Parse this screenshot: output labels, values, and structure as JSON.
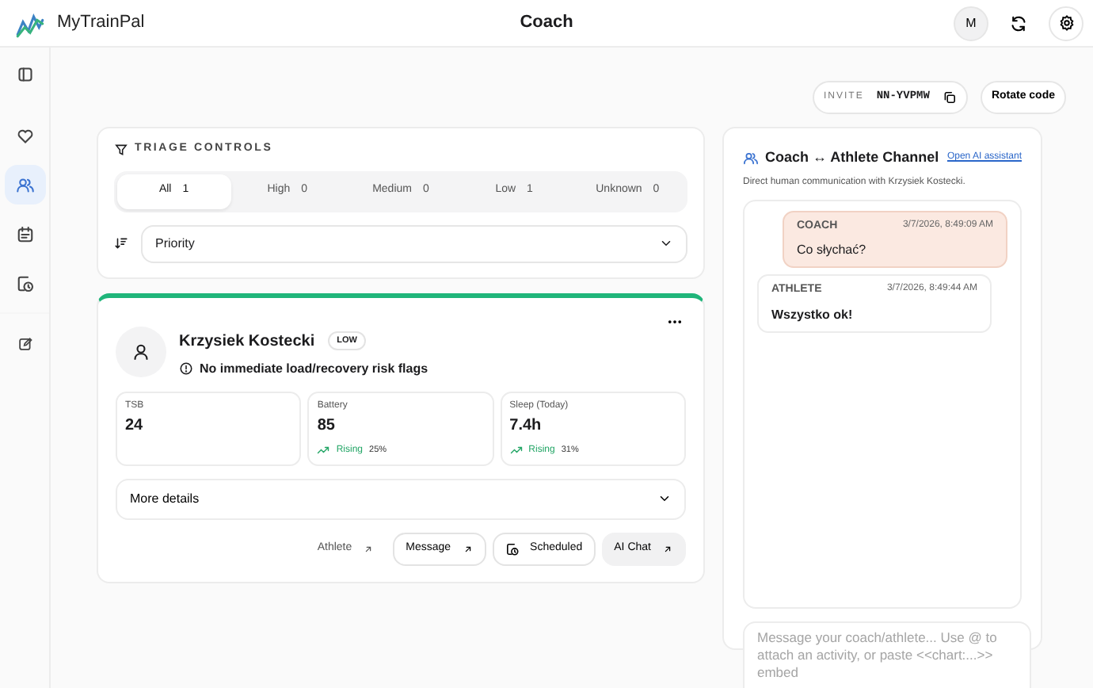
{
  "app": {
    "name": "MyTrainPal"
  },
  "header": {
    "title": "Coach",
    "avatar": "M"
  },
  "sidebar": {
    "items": [
      {
        "selected": false
      },
      {
        "selected": false
      },
      {
        "selected": true
      },
      {
        "selected": false
      },
      {
        "selected": false
      },
      {
        "selected": false
      }
    ]
  },
  "invite": {
    "label": "INVITE",
    "code": "NN-YVPMW",
    "rotate_button": "Rotate code"
  },
  "triage": {
    "title": "TRIAGE CONTROLS",
    "filters": [
      {
        "label": "All",
        "count": "1",
        "selected": true
      },
      {
        "label": "High",
        "count": "0",
        "selected": false
      },
      {
        "label": "Medium",
        "count": "0",
        "selected": false
      },
      {
        "label": "Low",
        "count": "1",
        "selected": false
      },
      {
        "label": "Unknown",
        "count": "0",
        "selected": false
      }
    ],
    "sort": {
      "value": "Priority"
    }
  },
  "athlete_card": {
    "name": "Krzysiek Kostecki",
    "priority": "LOW",
    "color": "#1fb57a",
    "flag": "No immediate load/recovery risk flags",
    "metrics": [
      {
        "label": "TSB",
        "value": "24"
      },
      {
        "label": "Battery",
        "value": "85",
        "trend": "Rising",
        "change": "25%"
      },
      {
        "label": "Sleep (Today)",
        "value": "7.4h",
        "trend": "Rising",
        "change": "31%"
      }
    ],
    "details": {
      "label": "More details",
      "expanded": false
    },
    "actions": [
      {
        "label": "Athlete",
        "kind": "link"
      },
      {
        "label": "Message",
        "kind": "outline"
      },
      {
        "label": "Scheduled",
        "kind": "schedule"
      },
      {
        "label": "AI Chat",
        "kind": "filled"
      }
    ]
  },
  "channel": {
    "title": "Coach ↔ Athlete Channel",
    "link": "Open AI assistant",
    "subtitle": "Direct human communication with Krzysiek Kostecki.",
    "messages": [
      {
        "sender": "COACH",
        "time": "3/7/2026, 8:49:09 AM",
        "text": "Co słychać?",
        "kind": "sent"
      },
      {
        "sender": "ATHLETE",
        "time": "3/7/2026, 8:49:44 AM",
        "text": "Wszystko ok!",
        "kind": "received"
      }
    ],
    "composer": {
      "placeholder": "Message your coach/athlete... Use @ to attach an activity, or paste <<chart:...>> embed"
    }
  }
}
